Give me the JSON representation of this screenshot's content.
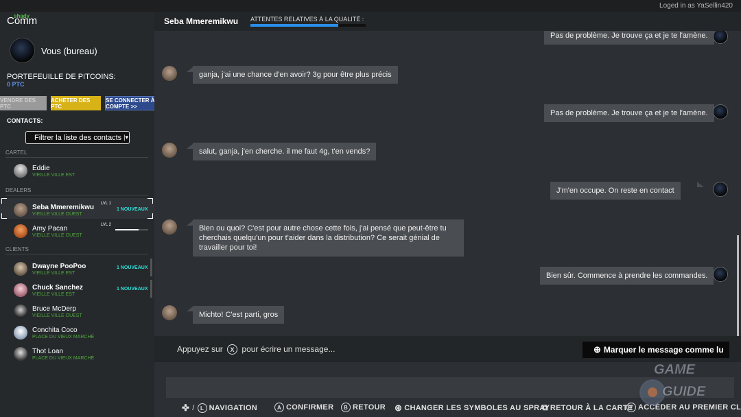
{
  "topbar": {
    "logged_in": "Loged in as YaSellin420"
  },
  "app": {
    "logo_small": "shady",
    "logo": "Comm"
  },
  "profile": {
    "name": "Vous (bureau)",
    "wallet_label": "PORTEFEUILLE DE PITCOINS:",
    "wallet_value": "0 PTC"
  },
  "buttons": {
    "sell": "VENDRE DES PTC",
    "buy": "ACHETER DES PTC",
    "connect": "SE CONNECTER À SON COMPTE >>"
  },
  "contacts": {
    "title": "CONTACTS:",
    "filter": "Filtrer la liste des contacts",
    "sections": {
      "cartel": "CARTEL",
      "dealers": "DEALERS",
      "clients": "CLIENTS"
    },
    "cartel": [
      {
        "name": "Eddie",
        "location": "VIEILLE VILLE EST"
      }
    ],
    "dealers": [
      {
        "name": "Seba Mmeremikwu",
        "location": "VIEILLE VILLE OUEST",
        "level": "LVL 1",
        "badge": "1 NOUVEAUX",
        "progress": 0
      },
      {
        "name": "Amy Pacan",
        "location": "VIEILLE VILLE OUEST",
        "level": "LVL 2",
        "progress": 0.7
      }
    ],
    "clients": [
      {
        "name": "Dwayne PooPoo",
        "location": "VIEILLE VILLE EST",
        "badge": "1 NOUVEAUX"
      },
      {
        "name": "Chuck Sanchez",
        "location": "VIEILLE VILLE EST",
        "badge": "1 NOUVEAUX"
      },
      {
        "name": "Bruce McDerp",
        "location": "VIEILLE VILLE OUEST"
      },
      {
        "name": "Conchita Coco",
        "location": "PLACE DU VIEUX MARCHÉ"
      },
      {
        "name": "Thot Loan",
        "location": "PLACE DU VIEUX MARCHÉ"
      }
    ]
  },
  "chat": {
    "contact_name": "Seba Mmeremikwu",
    "expectations_label": "ATTENTES RELATIVES À LA QUALITÉ :",
    "expectations_level": 0.76,
    "messages": [
      {
        "from": "me",
        "text": "Pas de problème. Je trouve ça et je te l'amène."
      },
      {
        "from": "them",
        "text": "ganja, j'ai une chance d'en avoir? 3g pour être plus précis"
      },
      {
        "from": "me",
        "text": "Pas de problème. Je trouve ça et je te l'amène."
      },
      {
        "from": "them",
        "text": "salut, ganja, j'en cherche. il me faut 4g, t'en vends?"
      },
      {
        "from": "me",
        "text": "J'm'en occupe. On reste en contact"
      },
      {
        "from": "them",
        "text": "Bien ou quoi? C'est pour autre chose cette fois, j'ai pensé que peut-être tu cherchais quelqu'un pour t'aider dans la distribution? Ce serait génial de travailler pour toi!"
      },
      {
        "from": "me",
        "text": "Bien sûr. Commence à prendre les commandes."
      },
      {
        "from": "them",
        "text": "Michto! C'est parti, gros"
      }
    ]
  },
  "composer": {
    "prompt_before": "Appuyez sur",
    "prompt_key": "X",
    "prompt_after": "pour écrire un message...",
    "mark_read": "Marquer le message comme lu"
  },
  "footer": {
    "navigation": "NAVIGATION",
    "confirm": "CONFIRMER",
    "back": "RETOUR",
    "spray": "CHANGER LES SYMBOLES AU SPRAY",
    "map": "RETOUR À LA CARTE",
    "first_client": "ACCÉDER AU PREMIER CLIENT",
    "keys": {
      "confirm": "A",
      "back": "B",
      "first_client": "Y"
    }
  },
  "watermark": {
    "line1": "GAME",
    "line2": "GUIDE"
  },
  "colors": {
    "accent_blue": "#2a8ee8",
    "buy_yellow": "#d7b318",
    "location_green": "#4fa83c",
    "badge_cyan": "#2ee0d8"
  }
}
